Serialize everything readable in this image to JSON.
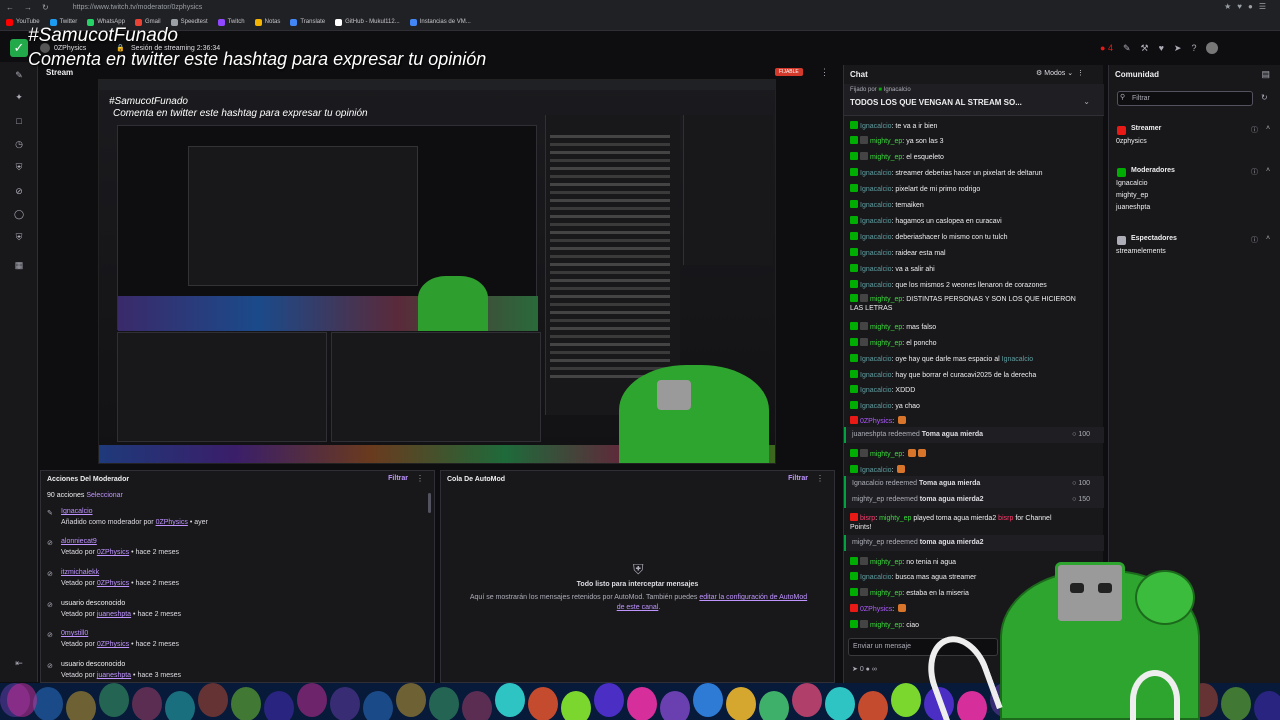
{
  "browser": {
    "url": "https://www.twitch.tv/moderator/0zphysics",
    "bookmarks": [
      {
        "label": "YouTube",
        "color": "#ff0000"
      },
      {
        "label": "Twitter",
        "color": "#1d9bf0"
      },
      {
        "label": "WhatsApp",
        "color": "#25d366"
      },
      {
        "label": "Gmail",
        "color": "#ea4335"
      },
      {
        "label": "Speedtest",
        "color": "#9aa0a6"
      },
      {
        "label": "Twitch",
        "color": "#9146ff"
      },
      {
        "label": "Notas",
        "color": "#f4b400"
      },
      {
        "label": "Translate",
        "color": "#4285f4"
      },
      {
        "label": "GitHub - Mukul112...",
        "color": "#ffffff"
      },
      {
        "label": "Instancias de VM...",
        "color": "#4285f4"
      }
    ]
  },
  "overlay": {
    "hashtag": "#SamucotFunado",
    "subtitle": "Comenta en twitter este hashtag para expresar tu opinión"
  },
  "header": {
    "streamer": "0ZPhysics",
    "session": "Sesión de streaming 2:36:34",
    "viewers": "4"
  },
  "stream": {
    "title": "Stream",
    "pin_label": "FIJABLE",
    "mini_hashtag": "#SamucotFunado",
    "mini_subtitle": "Comenta en twitter este hashtag para expresar tu opinión"
  },
  "mod_actions": {
    "title": "Acciones Del Moderador",
    "filter": "Filtrar",
    "count": "90 acciones",
    "select": "Seleccionar",
    "entries": [
      {
        "icon": "pencil-icon",
        "user": "Ignacalcio",
        "prefix": "Añadido como moderador por",
        "by": "0ZPhysics",
        "when": "• ayer"
      },
      {
        "icon": "ban-icon",
        "user": "alonniecat9",
        "prefix": "Vetado por",
        "by": "0ZPhysics",
        "when": "• hace 2 meses"
      },
      {
        "icon": "ban-icon",
        "user": "itzmichalekk",
        "prefix": "Vetado por",
        "by": "0ZPhysics",
        "when": "• hace 2 meses"
      },
      {
        "icon": "ban-icon",
        "user": "usuario desconocido",
        "prefix": "Vetado por",
        "by": "juaneshpta",
        "when": "• hace 2 meses"
      },
      {
        "icon": "ban-icon",
        "user": "0mystill0",
        "prefix": "Vetado por",
        "by": "0ZPhysics",
        "when": "• hace 2 meses"
      },
      {
        "icon": "ban-icon",
        "user": "usuario desconocido",
        "prefix": "Vetado por",
        "by": "juaneshpta",
        "when": "• hace 3 meses"
      }
    ]
  },
  "automod": {
    "title": "Cola De AutoMod",
    "filter": "Filtrar",
    "message": "Todo listo para interceptar mensajes",
    "info_prefix": "Aquí se mostrarán los mensajes retenidos por AutoMod. También puedes",
    "info_link": "editar la configuración de AutoMod de este canal",
    "info_suffix": "."
  },
  "chat": {
    "title": "Chat",
    "modes": "Modos",
    "pinned_by": "Fijado por",
    "pinned_user": "Ignacalcio",
    "pinned_text": "TODOS LOS QUE VENGAN AL STREAM SO...",
    "messages": [
      {
        "type": "msg",
        "user": "Ignacalcio",
        "cls": "n-ign",
        "text": "te va a ir bien"
      },
      {
        "type": "msg",
        "user": "mighty_ep",
        "cls": "n-mig",
        "text": "ya son las 3"
      },
      {
        "type": "msg",
        "user": "mighty_ep",
        "cls": "n-mig",
        "text": "el esqueleto"
      },
      {
        "type": "msg",
        "user": "Ignacalcio",
        "cls": "n-ign",
        "text": "streamer deberias hacer un pixelart de deltarun"
      },
      {
        "type": "msg",
        "user": "Ignacalcio",
        "cls": "n-ign",
        "text": "pixelart de mi primo rodrigo"
      },
      {
        "type": "msg",
        "user": "Ignacalcio",
        "cls": "n-ign",
        "text": "temaiken"
      },
      {
        "type": "msg",
        "user": "Ignacalcio",
        "cls": "n-ign",
        "text": "hagamos un caslopea en curacavi"
      },
      {
        "type": "msg",
        "user": "Ignacalcio",
        "cls": "n-ign",
        "text": "deberiashacer lo mismo con tu tulch"
      },
      {
        "type": "msg",
        "user": "Ignacalcio",
        "cls": "n-ign",
        "text": "raidear esta mal"
      },
      {
        "type": "msg",
        "user": "Ignacalcio",
        "cls": "n-ign",
        "text": "va a salir ahi"
      },
      {
        "type": "msg",
        "user": "Ignacalcio",
        "cls": "n-ign",
        "text": "que los mismos 2 weones llenaron de corazones"
      },
      {
        "type": "msg2",
        "user": "mighty_ep",
        "cls": "n-mig",
        "text": "DISTINTAS PERSONAS Y SON LOS QUE HICIERON",
        "text2": "LAS LETRAS"
      },
      {
        "type": "msg",
        "user": "mighty_ep",
        "cls": "n-mig",
        "text": "mas falso"
      },
      {
        "type": "msg",
        "user": "mighty_ep",
        "cls": "n-mig",
        "text": "el poncho"
      },
      {
        "type": "msgmention",
        "user": "Ignacalcio",
        "cls": "n-ign",
        "text": "oye hay que darle mas espacio al",
        "mention": "Ignacalcio"
      },
      {
        "type": "msg",
        "user": "Ignacalcio",
        "cls": "n-ign",
        "text": "hay que borrar el curacavi2025 de la derecha"
      },
      {
        "type": "msg",
        "user": "Ignacalcio",
        "cls": "n-ign",
        "text": "XDDD"
      },
      {
        "type": "msg",
        "user": "Ignacalcio",
        "cls": "n-ign",
        "text": "ya chao"
      },
      {
        "type": "emote",
        "user": "0ZPhysics",
        "cls": "n-ozp",
        "text": ""
      },
      {
        "type": "redeem",
        "user": "juaneshpta",
        "text": "Toma agua mierda",
        "pts": "100"
      },
      {
        "type": "emote2",
        "user": "mighty_ep",
        "cls": "n-mig",
        "text": ""
      },
      {
        "type": "emote",
        "user": "Ignacalcio",
        "cls": "n-ign",
        "text": ""
      },
      {
        "type": "redeem",
        "user": "Ignacalcio",
        "text": "Toma agua mierda",
        "pts": "100"
      },
      {
        "type": "redeem",
        "user": "mighty_ep",
        "text": "toma agua mierda2",
        "pts": "150"
      },
      {
        "type": "bisrp",
        "user": "bisrp",
        "text": "played toma agua mierda2",
        "mention": "mighty_ep",
        "tail": "for Channel",
        "tail2": "Points!"
      },
      {
        "type": "redeem",
        "user": "mighty_ep",
        "text": "toma agua mierda2",
        "pts": ""
      },
      {
        "type": "msg",
        "user": "mighty_ep",
        "cls": "n-mig",
        "text": "no tenia ni agua"
      },
      {
        "type": "msg",
        "user": "Ignacalcio",
        "cls": "n-ign",
        "text": "busca mas agua streamer"
      },
      {
        "type": "msg",
        "user": "mighty_ep",
        "cls": "n-mig",
        "text": "estaba en la miseria"
      },
      {
        "type": "emote",
        "user": "0ZPhysics",
        "cls": "n-ozp",
        "text": ""
      },
      {
        "type": "msg",
        "user": "mighty_ep",
        "cls": "n-mig",
        "text": "ciao"
      }
    ],
    "bisrp_prefix": "bisrp",
    "input_placeholder": "Enviar un mensaje",
    "points": "0"
  },
  "community": {
    "title": "Comunidad",
    "filter_placeholder": "Filtrar",
    "sections": [
      {
        "title": "Streamer",
        "color": "#e91916",
        "names": [
          "0zphysics"
        ]
      },
      {
        "title": "Moderadores",
        "color": "#00ad03",
        "names": [
          "Ignacalcio",
          "mighty_ep",
          "juaneshpta"
        ]
      },
      {
        "title": "Espectadores",
        "color": "#adadb8",
        "names": [
          "streamelements"
        ]
      }
    ]
  }
}
